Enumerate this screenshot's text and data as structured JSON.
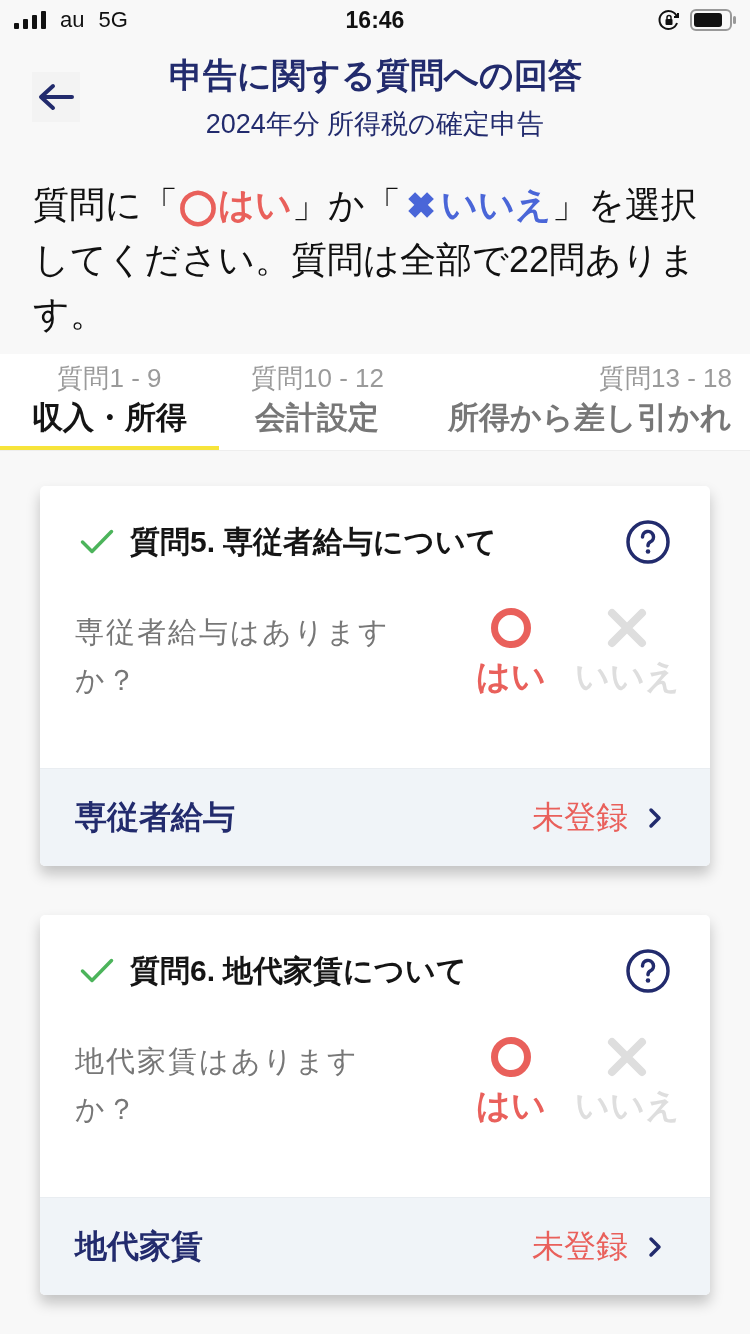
{
  "status_bar": {
    "carrier": "au",
    "network": "5G",
    "time": "16:46"
  },
  "header": {
    "title": "申告に関する質問への回答",
    "subtitle": "2024年分 所得税の確定申告"
  },
  "intro": [
    {
      "kind": "plain",
      "text": "質問に「"
    },
    {
      "kind": "yes",
      "mark": "◯",
      "text": "はい"
    },
    {
      "kind": "plain",
      "text": "」か「"
    },
    {
      "kind": "no",
      "mark": "✖",
      "text": "いいえ"
    },
    {
      "kind": "plain",
      "text": "」を選択してください。質問は全部で22問あります。"
    }
  ],
  "tabs": [
    {
      "range": "質問1 - 9",
      "label": "収入・所得",
      "selected": true
    },
    {
      "range": "質問10 - 12",
      "label": "会計設定",
      "selected": false
    },
    {
      "range": "質問13 - 18",
      "label": "所得から差し引かれ",
      "selected": false
    }
  ],
  "cards": [
    {
      "answered": true,
      "title": "質問5. 専従者給与について",
      "question": "専従者給与はありますか？",
      "options": [
        {
          "kind": "yes",
          "label": "はい",
          "selected": true
        },
        {
          "kind": "no",
          "label": "いいえ",
          "selected": false
        }
      ],
      "footer": {
        "label": "専従者給与",
        "status": "未登録"
      }
    },
    {
      "answered": true,
      "title": "質問6. 地代家賃について",
      "question": "地代家賃はありますか？",
      "options": [
        {
          "kind": "yes",
          "label": "はい",
          "selected": true
        },
        {
          "kind": "no",
          "label": "いいえ",
          "selected": false
        }
      ],
      "footer": {
        "label": "地代家賃",
        "status": "未登録"
      }
    }
  ]
}
